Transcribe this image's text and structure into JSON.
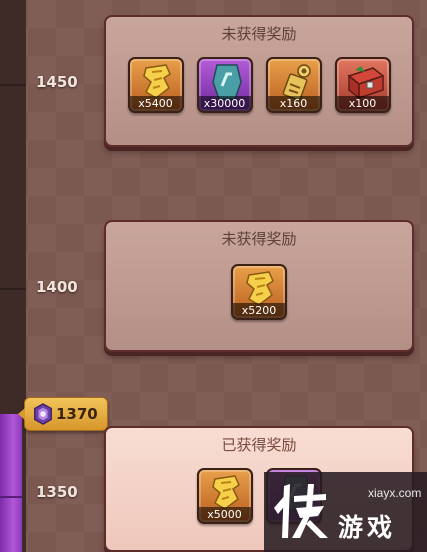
{
  "progress": {
    "current_score": "1370",
    "milestones": [
      "1450",
      "1400",
      "1350"
    ]
  },
  "tiers": [
    {
      "score": "1450",
      "status": "未获得奖励",
      "rewards": [
        {
          "icon": "gold-ticket-icon",
          "qty": "x5400"
        },
        {
          "icon": "teal-rune-icon",
          "qty": "x30000"
        },
        {
          "icon": "golden-key-scroll-icon",
          "qty": "x160"
        },
        {
          "icon": "red-treasure-chest-icon",
          "qty": "x100"
        }
      ]
    },
    {
      "score": "1400",
      "status": "未获得奖励",
      "rewards": [
        {
          "icon": "gold-ticket-icon",
          "qty": "x5200"
        }
      ]
    },
    {
      "score": "1350",
      "status": "已获得奖励",
      "rewards": [
        {
          "icon": "gold-ticket-icon",
          "qty": "x5000"
        },
        {
          "icon": "teal-rune-icon",
          "qty": ""
        }
      ]
    }
  ],
  "watermark": {
    "url": "xiayx.com",
    "name": "游戏",
    "logo": "侠"
  },
  "colors": {
    "progress_purple": "#a24ccc",
    "marker_gold": "#e2ae45",
    "locked_card": "#c0998f",
    "earned_card": "#f6d6cb"
  }
}
